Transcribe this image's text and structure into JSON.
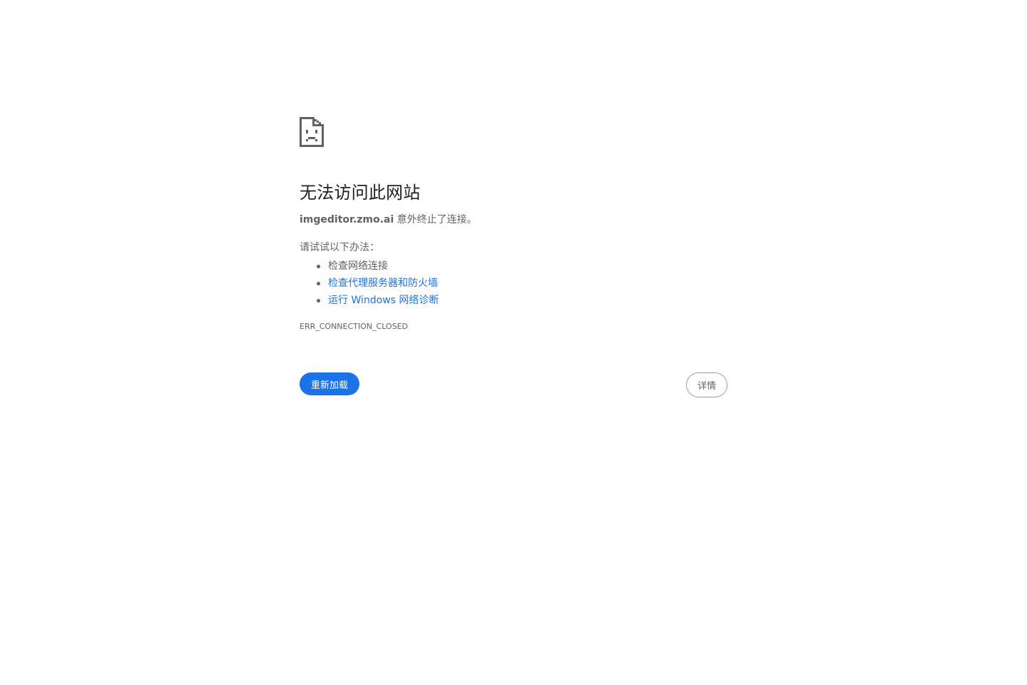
{
  "error_page": {
    "title": "无法访问此网站",
    "host": "imgeditor.zmo.ai",
    "message": " 意外终止了连接。",
    "suggestions_heading": "请试试以下办法：",
    "suggestions": [
      {
        "label": "检查网络连接",
        "link": false
      },
      {
        "label": "检查代理服务器和防火墙",
        "link": true
      },
      {
        "label": "运行 Windows 网络诊断",
        "link": true
      }
    ],
    "error_code": "ERR_CONNECTION_CLOSED",
    "reload_label": "重新加载",
    "details_label": "详情"
  },
  "icon": "sad-page-icon",
  "colors": {
    "accent": "#1a73e8",
    "text_secondary": "#5f6368",
    "text_primary": "#202124",
    "icon": "#5f6368"
  }
}
